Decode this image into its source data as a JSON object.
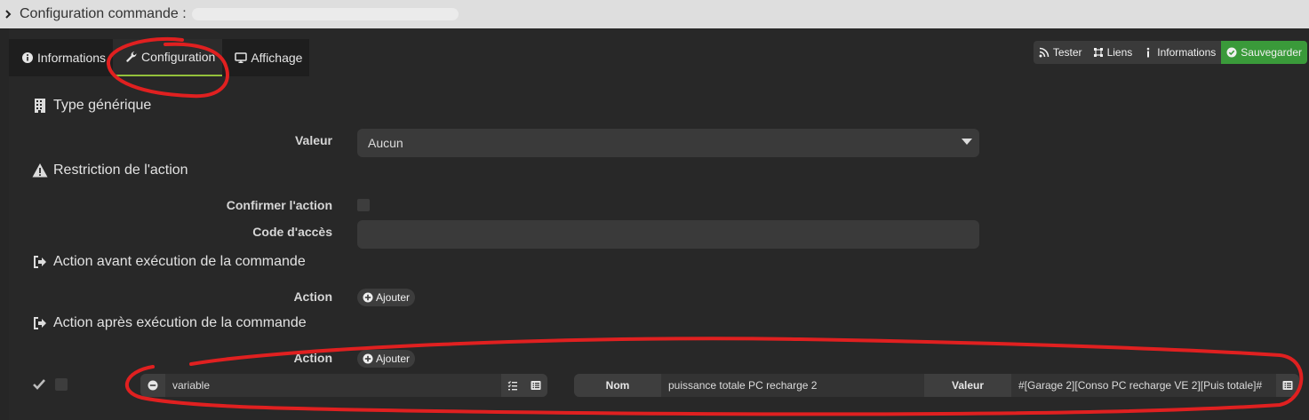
{
  "window": {
    "title": "Configuration commande :"
  },
  "tabs": [
    {
      "label": "Informations",
      "icon": "info-circle-icon"
    },
    {
      "label": "Configuration",
      "icon": "wrench-icon"
    },
    {
      "label": "Affichage",
      "icon": "monitor-icon"
    }
  ],
  "toolbar": {
    "tester": "Tester",
    "liens": "Liens",
    "informations": "Informations",
    "sauvegarder": "Sauvegarder"
  },
  "sections": {
    "generic_type": "Type générique",
    "restriction": "Restriction de l'action",
    "before_exec": "Action avant exécution de la commande",
    "after_exec": "Action après exécution de la commande"
  },
  "fields": {
    "valeur_label": "Valeur",
    "valeur_selected": "Aucun",
    "confirm_label": "Confirmer l'action",
    "code_label": "Code d'accès",
    "action_label_1": "Action",
    "action_label_2": "Action",
    "add_label_1": "Ajouter",
    "add_label_2": "Ajouter"
  },
  "action_row": {
    "cmd_value": "variable",
    "nom_label": "Nom",
    "nom_value": "puissance totale PC recharge 2",
    "valeur_label": "Valeur",
    "valeur_value": "#[Garage 2][Conso PC recharge VE 2][Puis totale]#"
  },
  "colors": {
    "active_tab_underline": "#93c13b",
    "save_button": "#3a9a3a",
    "annotation": "#e02020"
  }
}
